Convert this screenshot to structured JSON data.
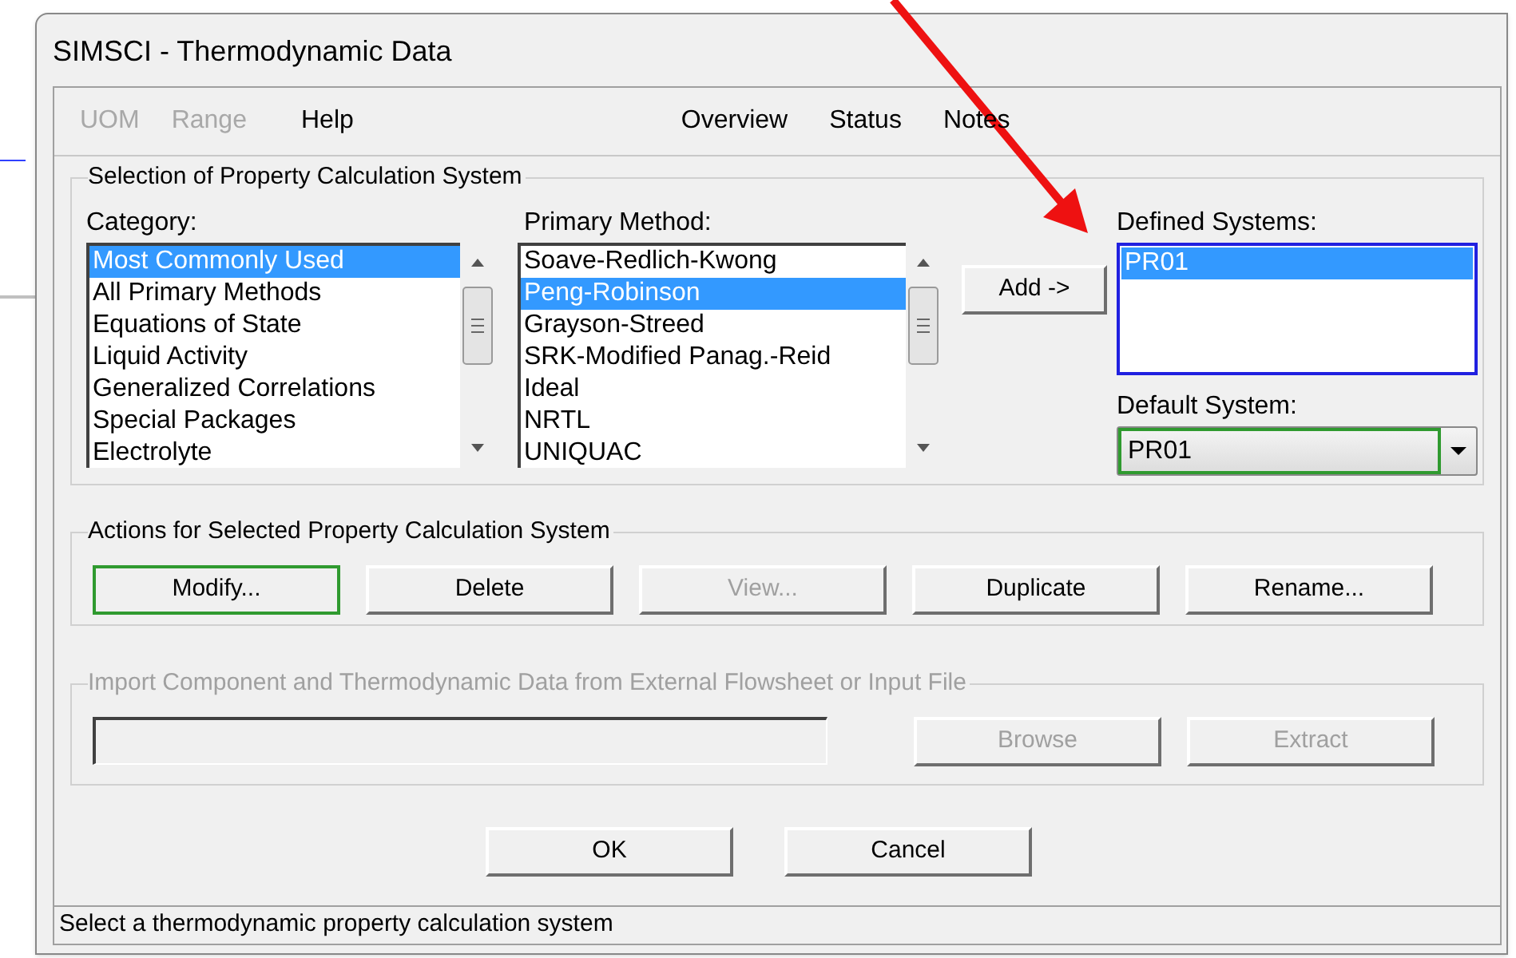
{
  "window": {
    "title": "SIMSCI - Thermodynamic Data"
  },
  "menu": [
    {
      "label": "UOM",
      "disabled": true
    },
    {
      "label": "Range",
      "disabled": true
    },
    {
      "label": "Help",
      "disabled": false
    }
  ],
  "view_menu": [
    {
      "label": "Overview"
    },
    {
      "label": "Status"
    },
    {
      "label": "Notes"
    }
  ],
  "selection_group": {
    "title": "Selection of Property Calculation System",
    "category": {
      "label": "Category:",
      "items": [
        {
          "label": "Most Commonly Used",
          "selected": true
        },
        {
          "label": "All Primary Methods",
          "selected": false
        },
        {
          "label": "Equations of State",
          "selected": false
        },
        {
          "label": "Liquid Activity",
          "selected": false
        },
        {
          "label": "Generalized Correlations",
          "selected": false
        },
        {
          "label": "Special Packages",
          "selected": false
        },
        {
          "label": "Electrolyte",
          "selected": false
        }
      ]
    },
    "primary_method": {
      "label": "Primary Method:",
      "items": [
        {
          "label": "Soave-Redlich-Kwong",
          "selected": false
        },
        {
          "label": "Peng-Robinson",
          "selected": true
        },
        {
          "label": "Grayson-Streed",
          "selected": false
        },
        {
          "label": "SRK-Modified Panag.-Reid",
          "selected": false
        },
        {
          "label": "Ideal",
          "selected": false
        },
        {
          "label": "NRTL",
          "selected": false
        },
        {
          "label": "UNIQUAC",
          "selected": false
        }
      ]
    },
    "add_button": "Add ->",
    "defined_systems": {
      "label": "Defined Systems:",
      "items": [
        {
          "label": "PR01",
          "selected": true
        }
      ]
    },
    "default_system": {
      "label": "Default System:",
      "value": "PR01"
    }
  },
  "actions_group": {
    "title": "Actions for Selected Property Calculation System",
    "buttons": [
      {
        "label": "Modify...",
        "disabled": false,
        "focused": true
      },
      {
        "label": "Delete",
        "disabled": false,
        "focused": false
      },
      {
        "label": "View...",
        "disabled": true,
        "focused": false
      },
      {
        "label": "Duplicate",
        "disabled": false,
        "focused": false
      },
      {
        "label": "Rename...",
        "disabled": false,
        "focused": false
      }
    ]
  },
  "import_group": {
    "title": "Import Component and Thermodynamic Data from External Flowsheet or Input File",
    "disabled": true,
    "buttons": [
      {
        "label": "Browse",
        "disabled": true
      },
      {
        "label": "Extract",
        "disabled": true
      }
    ]
  },
  "dialog_buttons": [
    {
      "label": "OK"
    },
    {
      "label": "Cancel"
    }
  ],
  "status_bar": "Select a thermodynamic property calculation system"
}
